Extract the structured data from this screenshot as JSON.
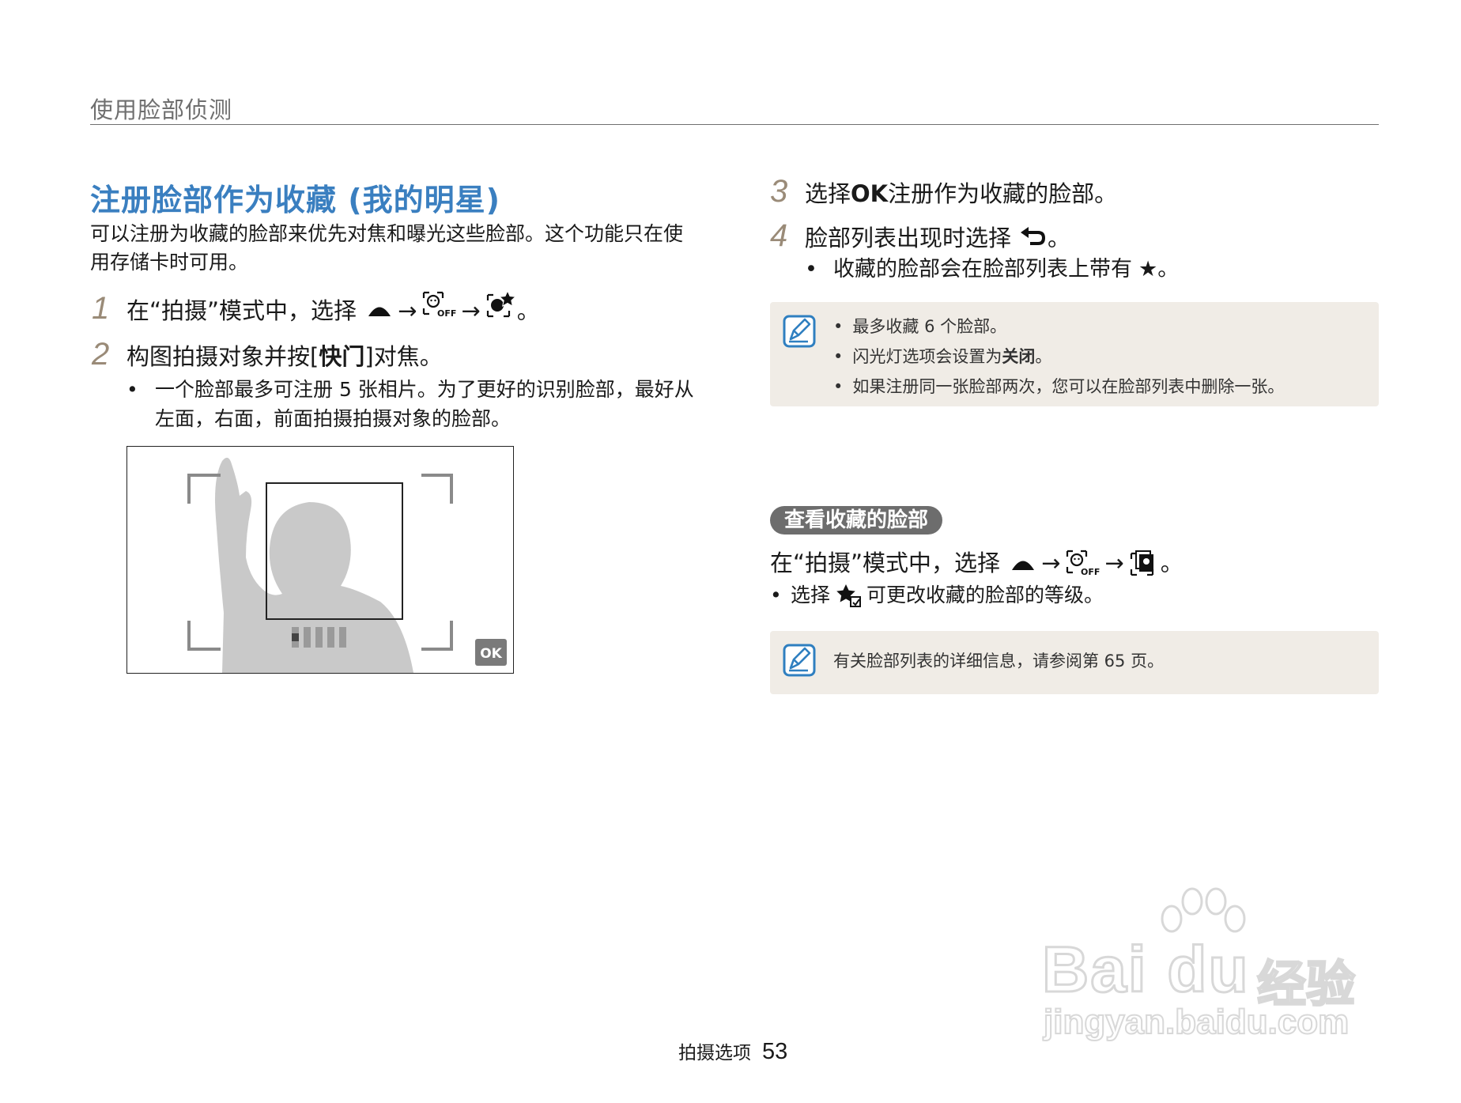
{
  "header": {
    "section": "使用脸部侦测"
  },
  "left": {
    "title": "注册脸部作为收藏 (我的明星)",
    "intro": "可以注册为收藏的脸部来优先对焦和曝光这些脸部。这个功能只在使用存储卡时可用。",
    "step1": {
      "num": "1",
      "text": "在“拍摄”模式中，选择",
      "end": "。"
    },
    "step2": {
      "num": "2",
      "text_a": "构图拍摄对象并按 ",
      "key": "快门",
      "text_b": " 对焦。"
    },
    "step2_bullet": "一个脸部最多可注册 5 张相片。为了更好的识别脸部，最好从左面，右面，前面拍摄拍摄对象的脸部。",
    "illus_button": "OK"
  },
  "right": {
    "step3": {
      "num": "3",
      "text_a": "选择 ",
      "ok": "OK",
      "text_b": " 注册作为收藏的脸部。"
    },
    "step4": {
      "num": "4",
      "text": "脸部列表出现时选择",
      "end": " 。"
    },
    "step4_bullet": {
      "text": "收藏的脸部会在脸部列表上带有",
      "star": "★",
      "end": " 。"
    },
    "note1": {
      "items": [
        "最多收藏 6 个脸部。",
        "闪光灯选项会设置为",
        "如果注册同一张脸部两次，您可以在脸部列表中删除一张。"
      ],
      "bold_off": "关闭",
      "period": "。"
    },
    "view": {
      "pill": "查看收藏的脸部",
      "step": "在“拍摄”模式中，选择",
      "step_end": "。",
      "bullet_a": "选择",
      "bullet_b": "可更改收藏的脸部的等级。"
    },
    "note2": "有关脸部列表的详细信息，请参阅第 65 页。"
  },
  "footer": {
    "label": "拍摄选项",
    "page": "53"
  },
  "watermark": {
    "brand": "Bai du",
    "cn": "经验",
    "url": "jingyan.baidu.com"
  },
  "icons": [
    "up-triangle-icon",
    "face-detect-off-icon",
    "face-star-icon",
    "back-return-icon",
    "note-pen-icon",
    "face-list-icon",
    "star-rank-icon"
  ]
}
